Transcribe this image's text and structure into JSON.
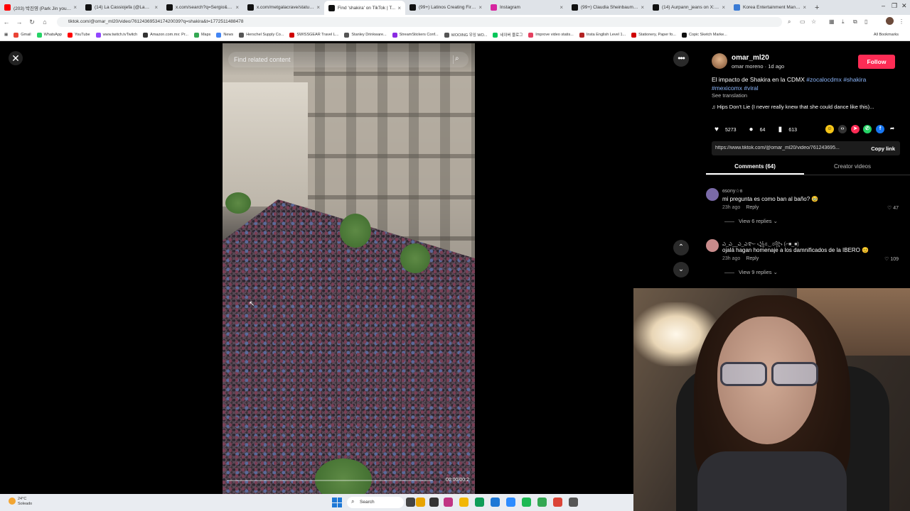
{
  "browser": {
    "tabs": [
      {
        "title": "(203) 박진영 (Park Jin young)",
        "fav_color": "#ff0000"
      },
      {
        "title": "(14) La Cassiojefa (@LaCassio...",
        "fav_color": "#111111"
      },
      {
        "title": "x.com/search?q=Sergio&src=...",
        "fav_color": "#111111"
      },
      {
        "title": "x.com/metgalacrave/status/2...",
        "fav_color": "#111111"
      },
      {
        "title": "Find 'shakira' on TikTok | T...",
        "fav_color": "#111111",
        "active": true
      },
      {
        "title": "(99+) Latinos Creating Fire Mu...",
        "fav_color": "#111111"
      },
      {
        "title": "Instagram",
        "fav_color": "#d6249f"
      },
      {
        "title": "(99+) Claudia Sheinbaum y la...",
        "fav_color": "#111111"
      },
      {
        "title": "(14) Aurpann_jeans on X: \"KE...",
        "fav_color": "#111111"
      },
      {
        "title": "Korea Entertainment Manage...",
        "fav_color": "#3a7bd5"
      }
    ],
    "url": "tiktok.com/@omar_ml20/video/7612436953417420039?q=shakira&t=1772511488478",
    "bookmarks": [
      {
        "label": "Gmail",
        "color": "#ea4335"
      },
      {
        "label": "WhatsApp",
        "color": "#25d366"
      },
      {
        "label": "YouTube",
        "color": "#ff0000"
      },
      {
        "label": "www.twitch.tvTwitch",
        "color": "#9146ff"
      },
      {
        "label": "Amazon.com.mx: Pr...",
        "color": "#333333"
      },
      {
        "label": "Maps",
        "color": "#34a853"
      },
      {
        "label": "News",
        "color": "#4285f4"
      },
      {
        "label": "Herschel Supply Co...",
        "color": "#555555"
      },
      {
        "label": "SWISSGEAR Travel L...",
        "color": "#d00000"
      },
      {
        "label": "Stanley Drinkware...",
        "color": "#555555"
      },
      {
        "label": "StreamStickers Conf...",
        "color": "#8a2be2"
      },
      {
        "label": "WOOING 우잉 WO...",
        "color": "#555555"
      },
      {
        "label": "네이버 블로그",
        "color": "#03c75a"
      },
      {
        "label": "Improve video statis...",
        "color": "#e4405f"
      },
      {
        "label": "Insta English Level 1...",
        "color": "#b22222"
      },
      {
        "label": "Stationery, Paper fo...",
        "color": "#d00000"
      },
      {
        "label": "Copic Sketch Marke...",
        "color": "#111111"
      }
    ],
    "all_bookmarks": "All Bookmarks"
  },
  "video": {
    "search_placeholder": "Find related content",
    "timestamp": "00:00/00:2",
    "progress": 0.0
  },
  "post": {
    "author_name": "omar_ml20",
    "author_sub": "omar moreno · 1d ago",
    "follow_label": "Follow",
    "caption_text": "El impacto de Shakira en la CDMX ",
    "hashtags_line1": "#zocalocdmx #shakira",
    "hashtags_line2": "#mexicomx #viral",
    "see_translation": "See translation",
    "music": "Hips Don't Lie (I never really knew that she could dance like this)...",
    "likes": "5273",
    "comments": "64",
    "saves": "613",
    "link": "https://www.tiktok.com/@omar_ml20/video/761243695...",
    "copy_link": "Copy link",
    "tab_comments": "Comments (64)",
    "tab_creator": "Creator videos"
  },
  "comments": [
    {
      "user": "ɞsony☆ɞ",
      "text": "mi pregunta es como ban al baño? 🥹",
      "time": "23h ago",
      "reply": "Reply",
      "likes": "47",
      "view_replies": "View 6 replies ⌄",
      "avatar_color": "#7a6aa8"
    },
    {
      "user": "ఎ_ఎ__ఎ_ఎ࿐ ꧁ಠ‿ಠ꧂ (⌐■_■)",
      "text": "ojalá hagan homenaje a los damnificados de la IBERO 😊",
      "time": "23h ago",
      "reply": "Reply",
      "likes": "109",
      "view_replies": "View 9 replies ⌄",
      "avatar_color": "#c98b8b"
    }
  ],
  "taskbar": {
    "temp": "24°C",
    "condition": "Soleado",
    "search": "Search"
  },
  "colors": {
    "accent": "#fe2c55",
    "hashtag": "#8ab4f8"
  }
}
